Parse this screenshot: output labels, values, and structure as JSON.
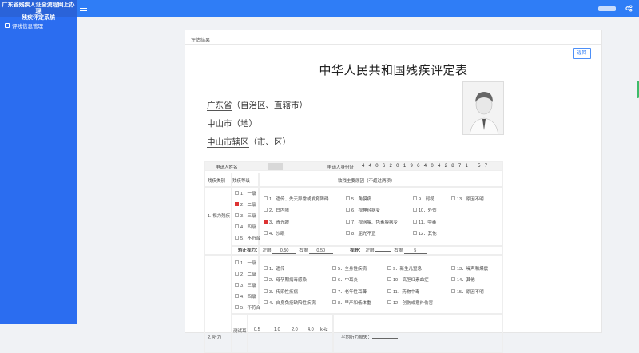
{
  "app": {
    "brand_line1": "广东省残疾人证全流程网上办理",
    "brand_line2": "残疾评定系统"
  },
  "sidebar": {
    "items": [
      {
        "label": "评残信息管理",
        "icon": "grid-icon"
      }
    ]
  },
  "tab": {
    "label": "评估结果"
  },
  "buttons": {
    "back": "返回"
  },
  "doc": {
    "title": "中华人民共和国残疾评定表",
    "province": "广东省",
    "province_suffix": "（自治区、直辖市）",
    "city": "中山市",
    "city_suffix": "（地）",
    "district": "中山市辖区",
    "district_suffix": "（市、区）"
  },
  "form": {
    "applicant_name_label": "申请人姓名",
    "applicant_id_label": "申请人身份证",
    "id_number": "4406201964042871 57",
    "col_category": "残疾类别",
    "col_level": "残疾等级",
    "col_cause": "致残主要原因（不超过两项）",
    "vision": {
      "category": "1. 视力残疾",
      "levels": [
        {
          "label": "1．一级",
          "checked": false
        },
        {
          "label": "2．二级",
          "checked": true
        },
        {
          "label": "3．三级",
          "checked": false
        },
        {
          "label": "4．四级",
          "checked": false
        },
        {
          "label": "5．不符合",
          "checked": false
        }
      ],
      "causes": [
        {
          "label": "1．遗传、先天异常或发育障碍",
          "checked": false
        },
        {
          "label": "2．白内障",
          "checked": false
        },
        {
          "label": "3．青光眼",
          "checked": true
        },
        {
          "label": "4．沙眼",
          "checked": false
        },
        {
          "label": "5．角膜病",
          "checked": false
        },
        {
          "label": "6．视神经病变",
          "checked": false
        },
        {
          "label": "7．视网膜、色素膜病变",
          "checked": false
        },
        {
          "label": "8．屈光不正",
          "checked": false
        },
        {
          "label": "9．弱视",
          "checked": false
        },
        {
          "label": "10．外伤",
          "checked": false
        },
        {
          "label": "11．中毒",
          "checked": false
        },
        {
          "label": "12．其他",
          "checked": false
        },
        {
          "label": "13．原因不明",
          "checked": false
        }
      ],
      "corrected_label": "矫正视力：",
      "left_label": "左眼",
      "left_value": "0.50",
      "right_label": "右眼",
      "right_value": "0.50",
      "field_label": "视野：",
      "field_left": "左眼",
      "field_right": "右眼",
      "field_right_value": "5"
    },
    "hearing": {
      "category": "2. 听力",
      "levels": [
        {
          "label": "1．一级",
          "checked": false
        },
        {
          "label": "2．二级",
          "checked": false
        },
        {
          "label": "3．三级",
          "checked": false
        },
        {
          "label": "4．四级",
          "checked": false
        },
        {
          "label": "5．不符合",
          "checked": false
        }
      ],
      "causes": [
        {
          "label": "1．遗传",
          "checked": false
        },
        {
          "label": "2．母孕期病毒感染",
          "checked": false
        },
        {
          "label": "3．传染性疾病",
          "checked": false
        },
        {
          "label": "4．自身免疫缺陷性疾病",
          "checked": false
        },
        {
          "label": "5．全身性疾病",
          "checked": false
        },
        {
          "label": "6．中耳炎",
          "checked": false
        },
        {
          "label": "7．老年性耳聋",
          "checked": false
        },
        {
          "label": "8．早产和低体重",
          "checked": false
        },
        {
          "label": "9．新生儿窒息",
          "checked": false
        },
        {
          "label": "10．高胆红素血症",
          "checked": false
        },
        {
          "label": "11．药物中毒",
          "checked": false
        },
        {
          "label": "12．创伤或意外伤害",
          "checked": false
        },
        {
          "label": "13．噪声和爆震",
          "checked": false
        },
        {
          "label": "14．其他",
          "checked": false
        },
        {
          "label": "15．原因不明",
          "checked": false
        }
      ],
      "freq_label": "测试耳",
      "freqs": [
        "0.5",
        "1.0",
        "2.0",
        "4.0",
        "kHz"
      ],
      "avg_label": "平均听力损失："
    }
  }
}
